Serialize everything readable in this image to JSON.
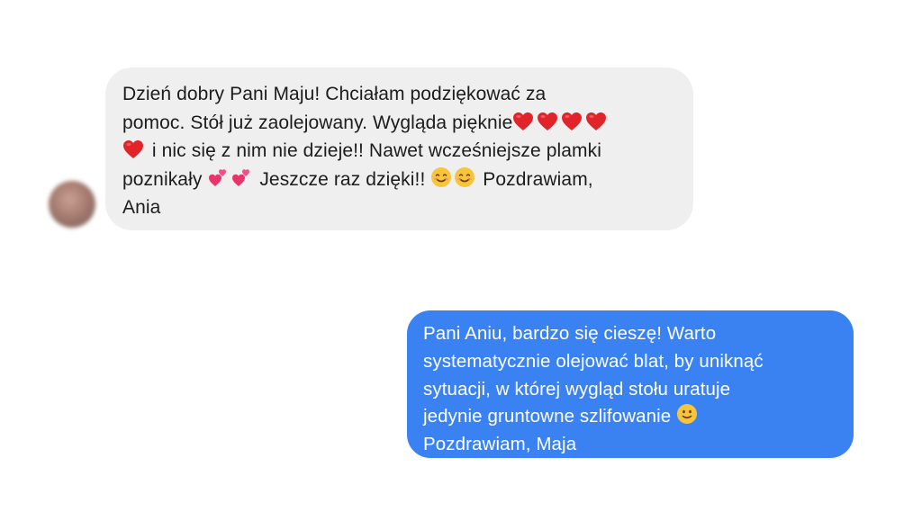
{
  "conversation": {
    "incoming": {
      "lines": [
        "Dzień dobry Pani Maju! Chciałam podziękować za",
        "pomoc. Stół już zaolejowany. Wygląda pięknie",
        " i nic się z nim nie dzieje!! Nawet wcześniejsze plamki",
        "poznikały ",
        " Jeszcze raz dzięki!! ",
        " Pozdrawiam,",
        "Ania"
      ],
      "emoji": {
        "hearts_after_line2": [
          "red-heart-icon",
          "red-heart-icon",
          "red-heart-icon",
          "red-heart-icon"
        ],
        "heart_start_line3": "red-heart-icon",
        "after_poznikaly": [
          "two-hearts-icon",
          "two-hearts-icon"
        ],
        "after_dzieki": [
          "smiling-face-icon",
          "smiling-face-icon"
        ]
      }
    },
    "outgoing": {
      "lines": [
        "Pani Aniu, bardzo się cieszę! Warto",
        "systematycznie olejować blat, by uniknąć",
        "sytuacji, w której wygląd stołu uratuje",
        "jedynie gruntowne szlifowanie ",
        "Pozdrawiam, Maja"
      ],
      "emoji": {
        "after_szlifowanie": "slightly-smiling-face-icon"
      }
    }
  },
  "colors": {
    "incoming_bubble": "#efefef",
    "incoming_text": "#1c1c1c",
    "outgoing_bubble": "#3a82f2",
    "outgoing_text": "#ffffff",
    "heart": "#e0242a"
  }
}
